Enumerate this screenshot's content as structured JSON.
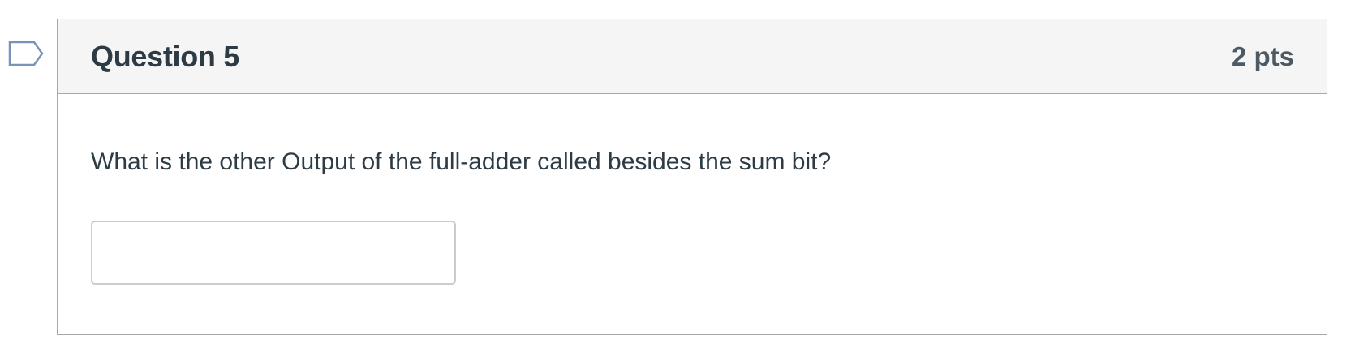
{
  "question": {
    "title": "Question 5",
    "points": "2 pts",
    "text": "What is the other Output of the full-adder called besides the sum bit?",
    "answer_value": "",
    "answer_placeholder": ""
  },
  "flag": {
    "icon": "bookmark-flag-icon",
    "color": "#7a93b8"
  },
  "colors": {
    "header_bg": "#f5f5f5",
    "border": "#a8a8a8",
    "text": "#2d3b45"
  }
}
